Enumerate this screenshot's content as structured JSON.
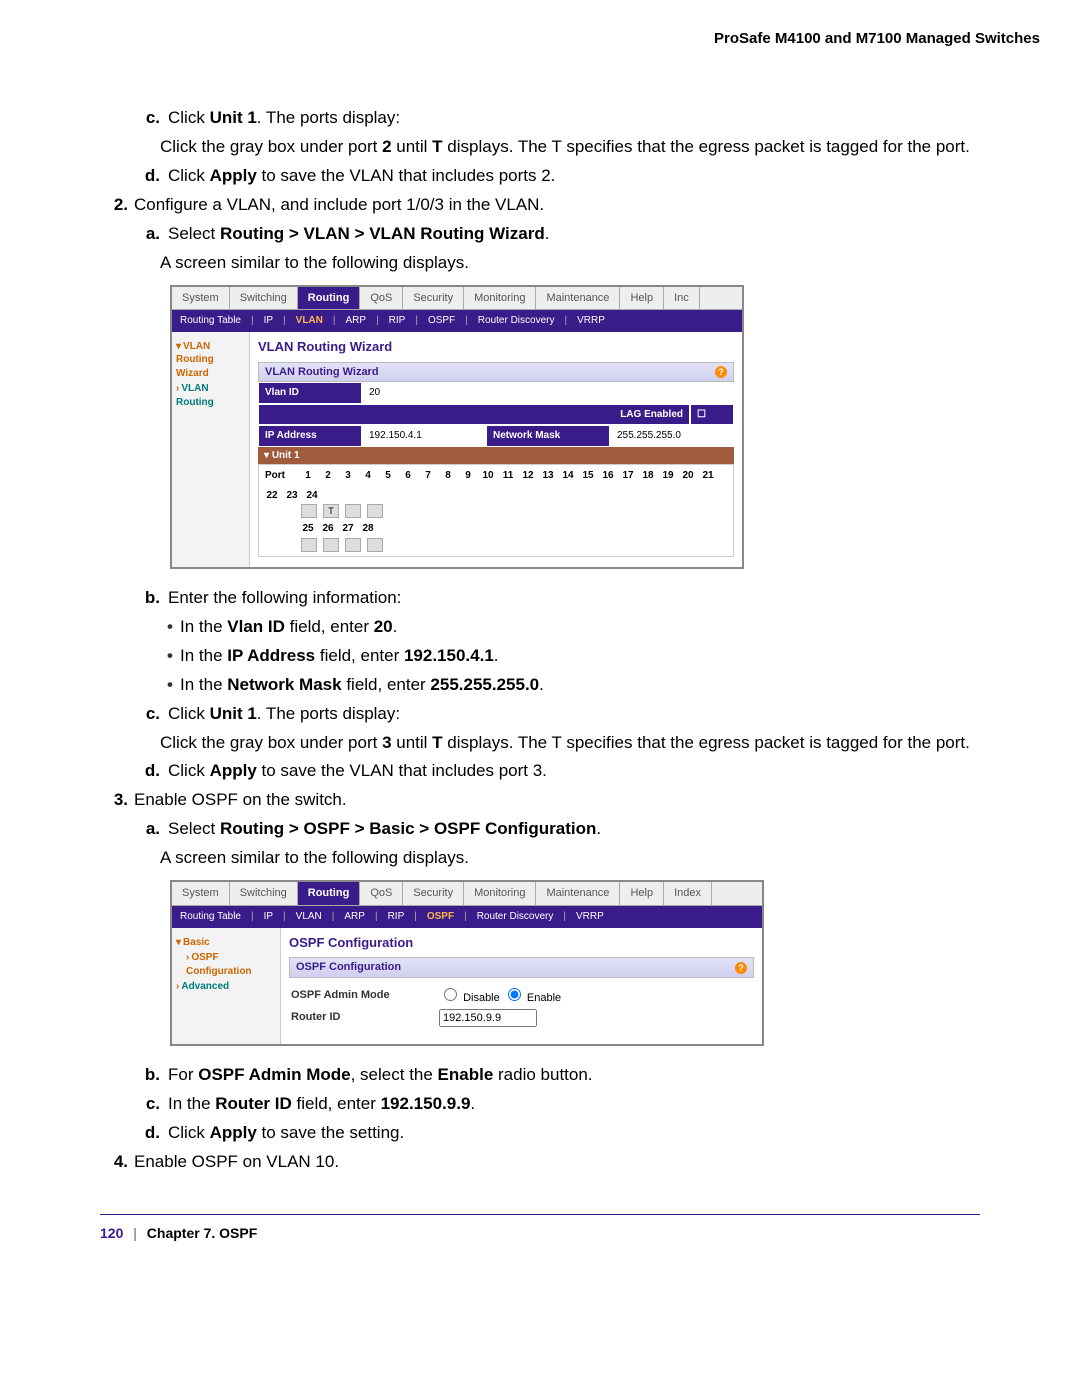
{
  "header": {
    "title": "ProSafe M4100 and M7100 Managed Switches"
  },
  "steps": {
    "c1_pre": "Click ",
    "c1_bold": "Unit 1",
    "c1_post": ". The ports display:",
    "c1_detail_a": "Click the gray box under port ",
    "c1_detail_b1": "2",
    "c1_detail_b2": " until ",
    "c1_detail_b3": "T",
    "c1_detail_b4": " displays. The T specifies that the egress packet is tagged for the port.",
    "d1_a": "Click ",
    "d1_b": "Apply",
    "d1_c": " to save the VLAN that includes ports 2.",
    "s2": "Configure a VLAN, and include port 1/0/3 in the VLAN.",
    "a2_a": "Select ",
    "a2_b": "Routing > VLAN > VLAN Routing Wizard",
    "a2_c": ".",
    "a2_line2": "A screen similar to the following displays.",
    "b2": "Enter the following information:",
    "b2_li1_a": "In the ",
    "b2_li1_b": "Vlan ID",
    "b2_li1_c": " field, enter ",
    "b2_li1_d": "20",
    "b2_li1_e": ".",
    "b2_li2_a": "In the ",
    "b2_li2_b": "IP Address",
    "b2_li2_c": " field, enter ",
    "b2_li2_d": "192.150.4.1",
    "b2_li2_e": ".",
    "b2_li3_a": "In the ",
    "b2_li3_b": "Network Mask",
    "b2_li3_c": " field, enter ",
    "b2_li3_d": "255.255.255.0",
    "b2_li3_e": ".",
    "c2_pre": "Click ",
    "c2_bold": "Unit 1",
    "c2_post": ". The ports display:",
    "c2_detail_a": "Click the gray box under port ",
    "c2_detail_b1": "3",
    "c2_detail_b2": " until ",
    "c2_detail_b3": "T",
    "c2_detail_b4": " displays. The T specifies that the egress packet is tagged for the port.",
    "d2_a": "Click ",
    "d2_b": "Apply",
    "d2_c": " to save the VLAN that includes port 3.",
    "s3": "Enable OSPF on the switch.",
    "a3_a": "Select ",
    "a3_b": "Routing > OSPF > Basic > OSPF Configuration",
    "a3_c": ".",
    "a3_line2": "A screen similar to the following displays.",
    "b3_a": "For ",
    "b3_b": "OSPF Admin Mode",
    "b3_c": ", select the ",
    "b3_d": "Enable",
    "b3_e": " radio button.",
    "c3_a": "In the ",
    "c3_b": "Router ID",
    "c3_c": " field, enter ",
    "c3_d": "192.150.9.9",
    "c3_e": ".",
    "d3_a": "Click ",
    "d3_b": "Apply",
    "d3_c": " to save the setting.",
    "s4": "Enable OSPF on VLAN 10."
  },
  "labels": {
    "let_c": "c.",
    "let_d": "d.",
    "let_a": "a.",
    "let_b": "b.",
    "num_2": "2.",
    "num_3": "3.",
    "num_4": "4.",
    "bullet": "•"
  },
  "shot1": {
    "tabs": [
      "System",
      "Switching",
      "Routing",
      "QoS",
      "Security",
      "Monitoring",
      "Maintenance",
      "Help",
      "Inc"
    ],
    "active_tab": "Routing",
    "subnav": [
      "Routing Table",
      "IP",
      "VLAN",
      "ARP",
      "RIP",
      "OSPF",
      "Router Discovery",
      "VRRP"
    ],
    "subnav_active": "VLAN",
    "sidebar": [
      "VLAN Routing Wizard",
      "VLAN Routing"
    ],
    "title": "VLAN Routing Wizard",
    "section": "VLAN Routing Wizard",
    "vlanid_label": "Vlan ID",
    "vlanid_value": "20",
    "lag_label": "LAG Enabled",
    "ip_label": "IP Address",
    "ip_value": "192.150.4.1",
    "mask_label": "Network Mask",
    "mask_value": "255.255.255.0",
    "unit": "Unit 1",
    "port_label": "Port",
    "ports_r1": [
      "1",
      "2",
      "3",
      "4",
      "5",
      "6",
      "7",
      "8",
      "9",
      "10",
      "11",
      "12",
      "13",
      "14",
      "15",
      "16",
      "17",
      "18",
      "19",
      "20",
      "21",
      "22",
      "23",
      "24"
    ],
    "ports_r2": [
      "25",
      "26",
      "27",
      "28"
    ],
    "t_mark": "T"
  },
  "shot2": {
    "tabs": [
      "System",
      "Switching",
      "Routing",
      "QoS",
      "Security",
      "Monitoring",
      "Maintenance",
      "Help",
      "Index"
    ],
    "active_tab": "Routing",
    "subnav": [
      "Routing Table",
      "IP",
      "VLAN",
      "ARP",
      "RIP",
      "OSPF",
      "Router Discovery",
      "VRRP"
    ],
    "subnav_active": "OSPF",
    "sidebar": {
      "basic": "Basic",
      "ospf_conf": "OSPF Configuration",
      "advanced": "Advanced"
    },
    "title": "OSPF Configuration",
    "section": "OSPF Configuration",
    "admin_label": "OSPF Admin Mode",
    "disable": "Disable",
    "enable": "Enable",
    "routerid_label": "Router ID",
    "routerid_value": "192.150.9.9"
  },
  "footer": {
    "page": "120",
    "sep": "|",
    "chapter": "Chapter 7.  OSPF"
  }
}
